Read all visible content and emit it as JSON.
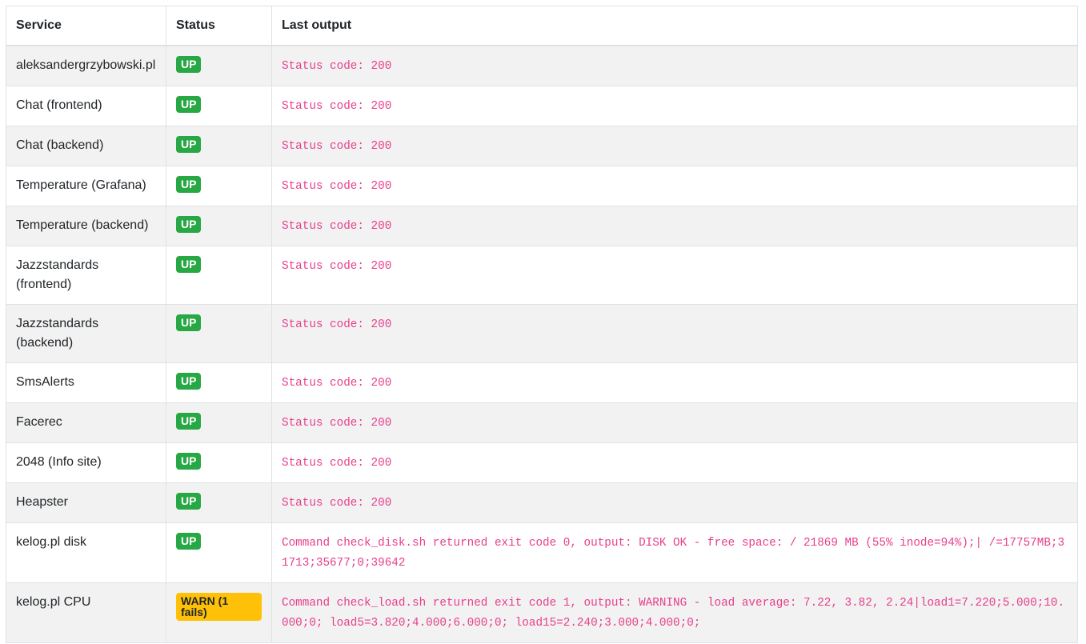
{
  "table": {
    "headers": {
      "service": "Service",
      "status": "Status",
      "output": "Last output"
    },
    "rows": [
      {
        "service": "aleksandergrzybowski.pl",
        "status": "UP",
        "status_type": "up",
        "output": "Status code: 200"
      },
      {
        "service": "Chat (frontend)",
        "status": "UP",
        "status_type": "up",
        "output": "Status code: 200"
      },
      {
        "service": "Chat (backend)",
        "status": "UP",
        "status_type": "up",
        "output": "Status code: 200"
      },
      {
        "service": "Temperature (Grafana)",
        "status": "UP",
        "status_type": "up",
        "output": "Status code: 200"
      },
      {
        "service": "Temperature (backend)",
        "status": "UP",
        "status_type": "up",
        "output": "Status code: 200"
      },
      {
        "service": "Jazzstandards (frontend)",
        "status": "UP",
        "status_type": "up",
        "output": "Status code: 200"
      },
      {
        "service": "Jazzstandards (backend)",
        "status": "UP",
        "status_type": "up",
        "output": "Status code: 200"
      },
      {
        "service": "SmsAlerts",
        "status": "UP",
        "status_type": "up",
        "output": "Status code: 200"
      },
      {
        "service": "Facerec",
        "status": "UP",
        "status_type": "up",
        "output": "Status code: 200"
      },
      {
        "service": "2048 (Info site)",
        "status": "UP",
        "status_type": "up",
        "output": "Status code: 200"
      },
      {
        "service": "Heapster",
        "status": "UP",
        "status_type": "up",
        "output": "Status code: 200"
      },
      {
        "service": "kelog.pl disk",
        "status": "UP",
        "status_type": "up",
        "output": "Command check_disk.sh returned exit code 0, output: DISK OK - free space: / 21869 MB (55% inode=94%);| /=17757MB;31713;35677;0;39642"
      },
      {
        "service": "kelog.pl CPU",
        "status": "WARN (1 fails)",
        "status_type": "warn",
        "output": "Command check_load.sh returned exit code 1, output: WARNING - load average: 7.22, 3.82, 2.24|load1=7.220;5.000;10.000;0; load5=3.820;4.000;6.000;0; load15=2.240;3.000;4.000;0;"
      }
    ]
  },
  "colors": {
    "up": "#28a745",
    "warn": "#ffc107",
    "code": "#e83e8c",
    "stripe": "#f2f2f2",
    "border": "#dee2e6"
  }
}
